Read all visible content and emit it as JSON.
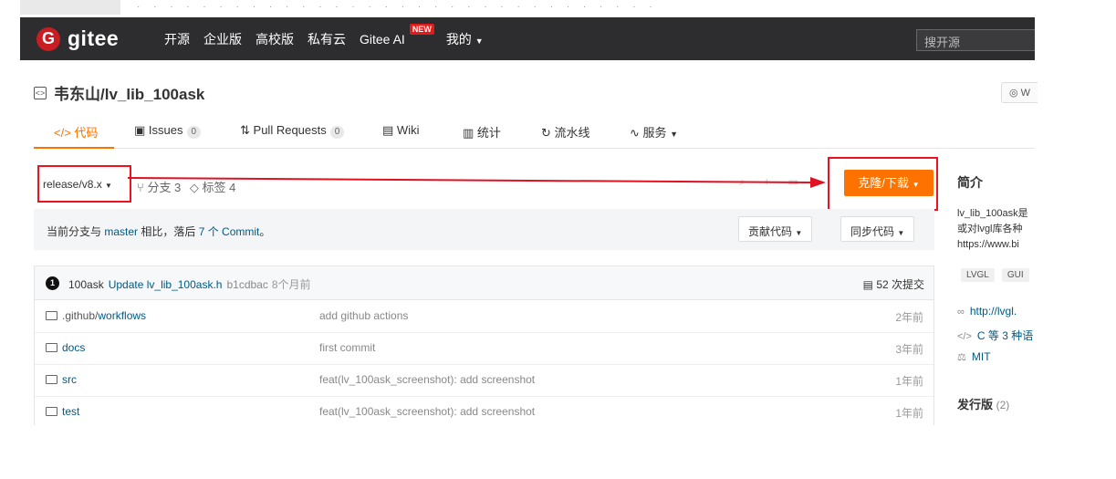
{
  "header": {
    "logo_text": "gitee",
    "logo_mark": "G",
    "nav": [
      "开源",
      "企业版",
      "高校版",
      "私有云",
      "Gitee AI"
    ],
    "new_badge": "NEW",
    "mine": "我的",
    "search_placeholder": "搜开源"
  },
  "repo": {
    "title": "韦东山/lv_lib_100ask",
    "watch_label": "W"
  },
  "tabs": {
    "code": "代码",
    "issues": "Issues",
    "issues_count": "0",
    "pr": "Pull Requests",
    "pr_count": "0",
    "wiki": "Wiki",
    "stats": "统计",
    "pipeline": "流水线",
    "services": "服务"
  },
  "branch": {
    "current": "release/v8.x",
    "branches": "分支 3",
    "tags": "标签 4"
  },
  "clone_button": "克隆/下载",
  "compare": {
    "prefix": "当前分支与 ",
    "base": "master",
    "middle": " 相比，落后 ",
    "commits_link": "7 个 Commit",
    "suffix": "。",
    "contribute": "贡献代码",
    "sync": "同步代码"
  },
  "last_commit": {
    "author_initial": "1",
    "author": "100ask",
    "message": "Update lv_lib_100ask.h",
    "hash": "b1cdbac",
    "time": "8个月前",
    "total": "52 次提交"
  },
  "files": [
    {
      "name_prefix": ".github/",
      "name": "workflows",
      "message": "add github actions",
      "time": "2年前"
    },
    {
      "name_prefix": "",
      "name": "docs",
      "message": "first commit",
      "time": "3年前"
    },
    {
      "name_prefix": "",
      "name": "src",
      "message": "feat(lv_100ask_screenshot): add screenshot",
      "time": "1年前"
    },
    {
      "name_prefix": "",
      "name": "test",
      "message": "feat(lv_100ask_screenshot): add screenshot",
      "time": "1年前"
    }
  ],
  "sidebar": {
    "intro_heading": "简介",
    "desc_line1": "lv_lib_100ask是",
    "desc_line2": "或对lvgl库各种",
    "desc_line3": "https://www.bi",
    "tags": [
      "LVGL",
      "GUI"
    ],
    "homepage": "http://lvgl.",
    "languages": "C 等 3 种语",
    "license": "MIT",
    "releases_heading": "发行版",
    "releases_count": "(2)"
  },
  "colors": {
    "accent": "#fe7300",
    "header_bg": "#2d2d30",
    "annotation_red": "#e11122",
    "link": "#005980"
  }
}
